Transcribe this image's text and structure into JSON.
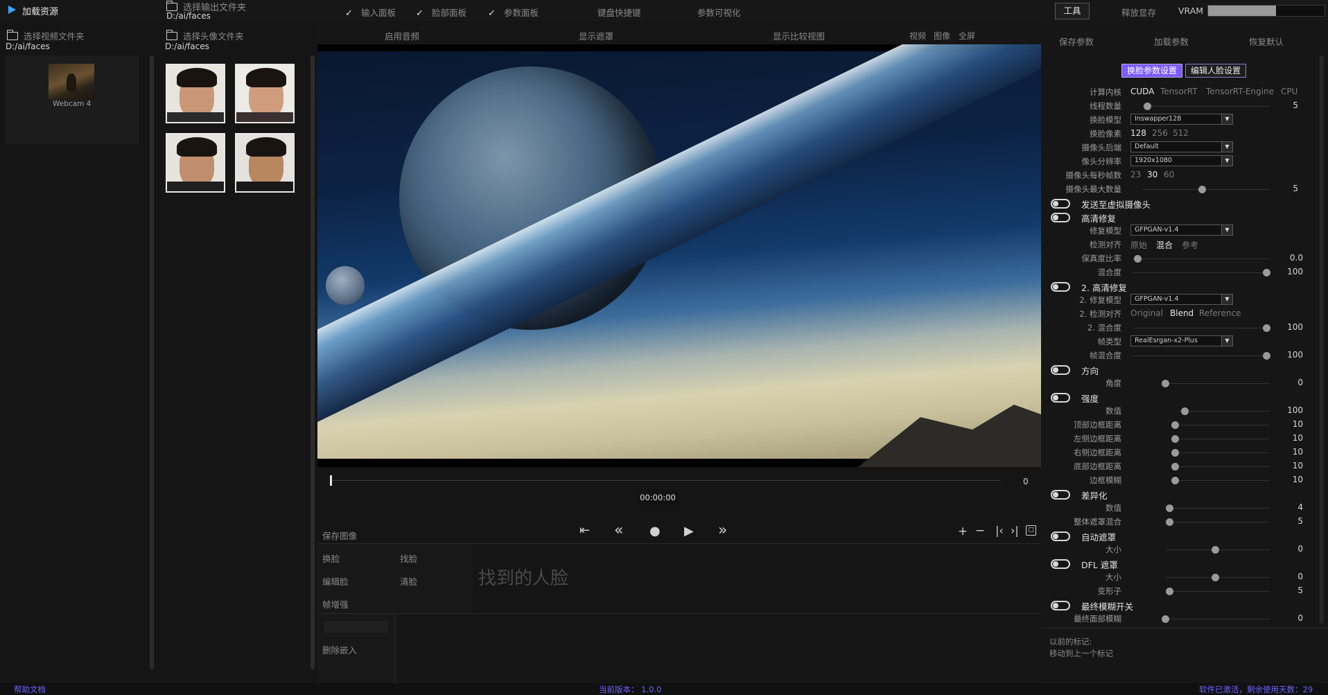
{
  "topbar": {
    "load_source": "加载资源",
    "output_label": "选择输出文件夹",
    "output_path": "D:/ai/faces",
    "check_input_panel": "输入面板",
    "check_face_panel": "脸部面板",
    "check_param_panel": "参数面板",
    "keyboard_shortcuts": "键盘快捷键",
    "param_visualize": "参数可视化",
    "tools": "工具",
    "release_vram": "释放显存",
    "vram": "VRAM"
  },
  "left": {
    "video_label": "选择视频文件夹",
    "video_path": "D:/ai/faces",
    "webcam_label": "Webcam 4"
  },
  "faces": {
    "label": "选择头像文件夹",
    "path": "D:/ai/faces"
  },
  "center": {
    "enable_audio": "启用音频",
    "show_mask": "显示遮罩",
    "show_compare": "显示比较视图",
    "view_video": "视频",
    "view_image": "图像",
    "view_full": "全屏",
    "frame_number": "0",
    "timecode": "00:00:00",
    "save_image": "保存图像",
    "btn_swap": "换脸",
    "btn_edit": "编辑脸",
    "btn_enhance": "帧增强",
    "btn_find": "找脸",
    "btn_clear": "清脸",
    "found_faces": "找到的人脸",
    "delete_embed": "删除嵌入"
  },
  "right": {
    "save_params": "保存参数",
    "load_params": "加载参数",
    "restore_default": "恢复默认",
    "tab_swap_settings": "换脸参数设置",
    "tab_edit_face": "编辑人脸设置",
    "compute_label": "计算内核",
    "compute_opts": [
      "CUDA",
      "TensorRT",
      "TensorRT-Engine",
      "CPU"
    ],
    "threads_label": "线程数量",
    "threads_val": "5",
    "model_label": "换脸模型",
    "model_val": "Inswapper128",
    "pixels_label": "换脸像素",
    "pixels_opts": [
      "128",
      "256",
      "512"
    ],
    "cam_backend_label": "摄像头后端",
    "cam_backend_val": "Default",
    "cam_res_label": "像头分辨率",
    "cam_res_val": "1920x1080",
    "cam_fps_label": "摄像头每秒帧数",
    "cam_fps_opts": [
      "23",
      "30",
      "60"
    ],
    "cam_max_label": "摄像头最大数量",
    "cam_max_val": "5",
    "virtual_cam": "发送至虚拟摄像头",
    "hd_restore": "高清修复",
    "restore_model_label": "修复模型",
    "restore_model_val": "GFPGAN-v1.4",
    "detect_align_label": "检测对齐",
    "detect_align_opts": [
      "原始",
      "混合",
      "参考"
    ],
    "fidelity_label": "保真度比率",
    "fidelity_val": "0.0",
    "blend_label": "混合度",
    "blend_val": "100",
    "hd_restore2": "2. 高清修复",
    "restore_model2_label": "2. 修复模型",
    "restore_model2_val": "GFPGAN-v1.4",
    "detect_align2_label": "2. 检测对齐",
    "detect_align2_opts": [
      "Original",
      "Blend",
      "Reference"
    ],
    "blend2_label": "2. 混合度",
    "blend2_val": "100",
    "frame_type_label": "帧类型",
    "frame_type_val": "RealEsrgan-x2-Plus",
    "frame_blend_label": "帧混合度",
    "frame_blend_val": "100",
    "orientation": "方向",
    "angle_label": "角度",
    "angle_val": "0",
    "strength": "强度",
    "amount_label": "数值",
    "amount_val": "100",
    "top_border_label": "顶部边框距离",
    "top_border_val": "10",
    "left_border_label": "左侧边框距离",
    "left_border_val": "10",
    "right_border_label": "右侧边框距离",
    "right_border_val": "10",
    "bottom_border_label": "底部边框距离",
    "bottom_border_val": "10",
    "border_blur_label": "边框模糊",
    "border_blur_val": "10",
    "diff": "差异化",
    "diff_amount_label": "数值",
    "diff_amount_val": "4",
    "overall_mask_label": "整体遮罩混合",
    "overall_mask_val": "5",
    "auto_mask": "自动遮罩",
    "auto_size_label": "大小",
    "auto_size_val": "0",
    "dfl_mask": "DFL 遮罩",
    "dfl_size_label": "大小",
    "dfl_size_val": "0",
    "deform_label": "变形子",
    "deform_val": "5",
    "final_blur": "最终模糊开关",
    "final_face_blur_label": "最终面部模糊",
    "final_face_blur_val": "0",
    "prev_marker": "以前的标记:",
    "move_marker": "移动到上一个标记"
  },
  "footer": {
    "help": "帮助文档",
    "version": "当前版本：  1.0.0",
    "license": "软件已激活，剩余使用天数：29"
  },
  "colors": {
    "bg": "#151515",
    "accent_purple": "#7a5cff",
    "footer_text": "#6d63ff"
  }
}
